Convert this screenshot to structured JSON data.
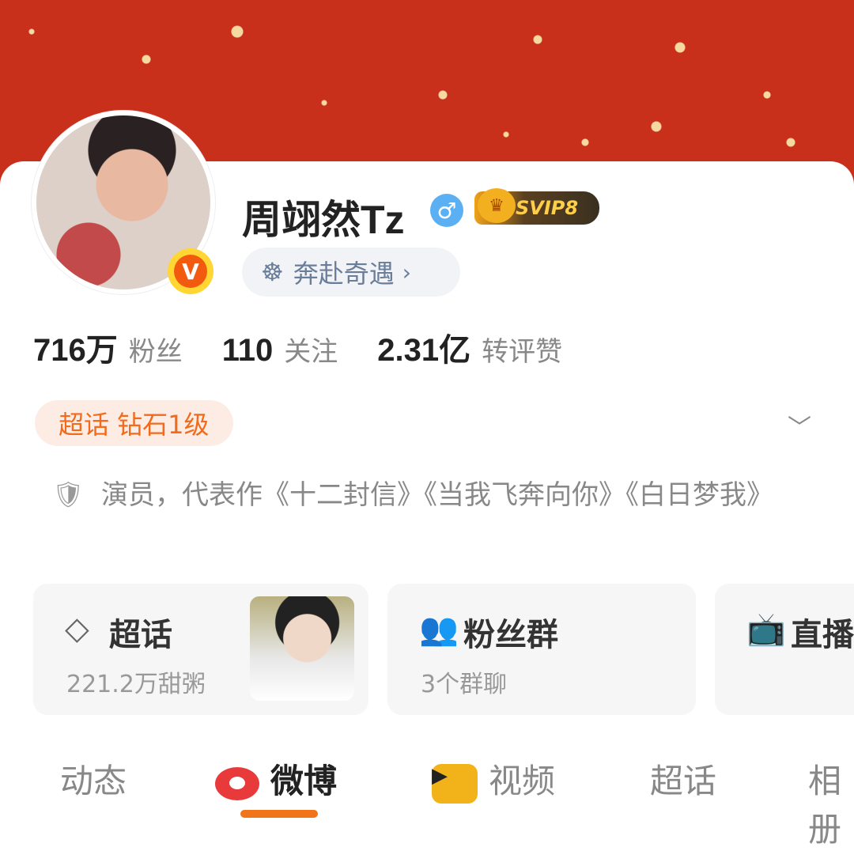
{
  "profile": {
    "name": "周翊然Tz",
    "gender_symbol": "♂",
    "vip_label": "SVIP8",
    "verified_mark": "V",
    "qiyu_label": "奔赴奇遇"
  },
  "stats": [
    {
      "value": "716万",
      "label": "粉丝"
    },
    {
      "value": "110",
      "label": "关注"
    },
    {
      "value": "2.31亿",
      "label": "转评赞"
    }
  ],
  "super_badge": "超话 钻石1级",
  "bio": "演员，代表作《十二封信》《当我飞奔向你》《白日梦我》",
  "tiles": {
    "supertopic": {
      "title": "超话",
      "subtitle": "221.2万甜粥"
    },
    "fangroup": {
      "title": "粉丝群",
      "subtitle": "3个群聊"
    },
    "live": {
      "title": "直播"
    }
  },
  "tabs": [
    "动态",
    "微博",
    "视频",
    "超话",
    "相册"
  ],
  "active_tab": "微博",
  "colors": {
    "banner": "#c8301c",
    "accent_orange": "#f2741a",
    "verified": "#f25a0f",
    "gender": "#5ab0f2"
  }
}
